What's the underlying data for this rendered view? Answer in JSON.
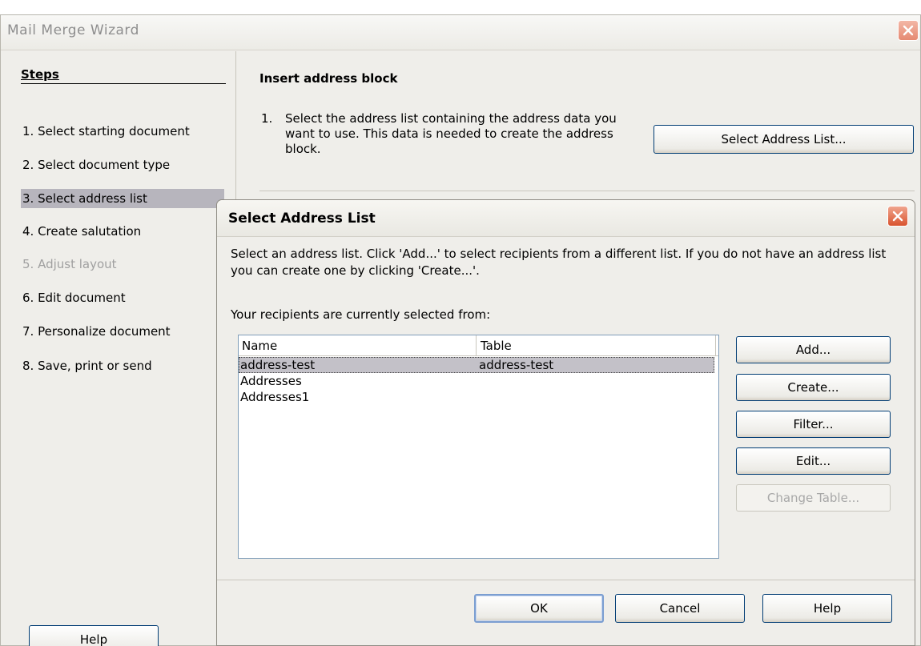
{
  "wizard": {
    "title": "Mail Merge Wizard",
    "steps_heading": "Steps",
    "steps": [
      {
        "label": "1.  Select starting document"
      },
      {
        "label": "2.  Select document type"
      },
      {
        "label": "3.  Select address list"
      },
      {
        "label": "4.  Create salutation"
      },
      {
        "label": "5.  Adjust layout"
      },
      {
        "label": "6.  Edit document"
      },
      {
        "label": "7.  Personalize document"
      },
      {
        "label": "8.  Save, print or send"
      }
    ],
    "selected_step": 3,
    "disabled_step": 5,
    "section_heading": "Insert address block",
    "instruction_number": "1.",
    "instruction_text": "Select the address list containing the address data you want to use. This data is needed to create the address block.",
    "select_address_list_button": "Select Address List...",
    "help_button": "Help"
  },
  "dialog": {
    "title": "Select Address List",
    "description": "Select an address list. Click 'Add...' to select recipients from a different list. If you do not have an address list you can create one by clicking 'Create...'.",
    "current_label": "Your recipients are currently selected from:",
    "columns": {
      "name": "Name",
      "table": "Table"
    },
    "rows": [
      {
        "name": "address-test",
        "table": "address-test",
        "selected": true
      },
      {
        "name": "Addresses",
        "table": ""
      },
      {
        "name": "Addresses1",
        "table": ""
      }
    ],
    "buttons": {
      "add": "Add...",
      "create": "Create...",
      "filter": "Filter...",
      "edit": "Edit...",
      "change_table": "Change Table...",
      "ok": "OK",
      "cancel": "Cancel",
      "help": "Help"
    }
  },
  "icons": {
    "close": "close-icon"
  }
}
